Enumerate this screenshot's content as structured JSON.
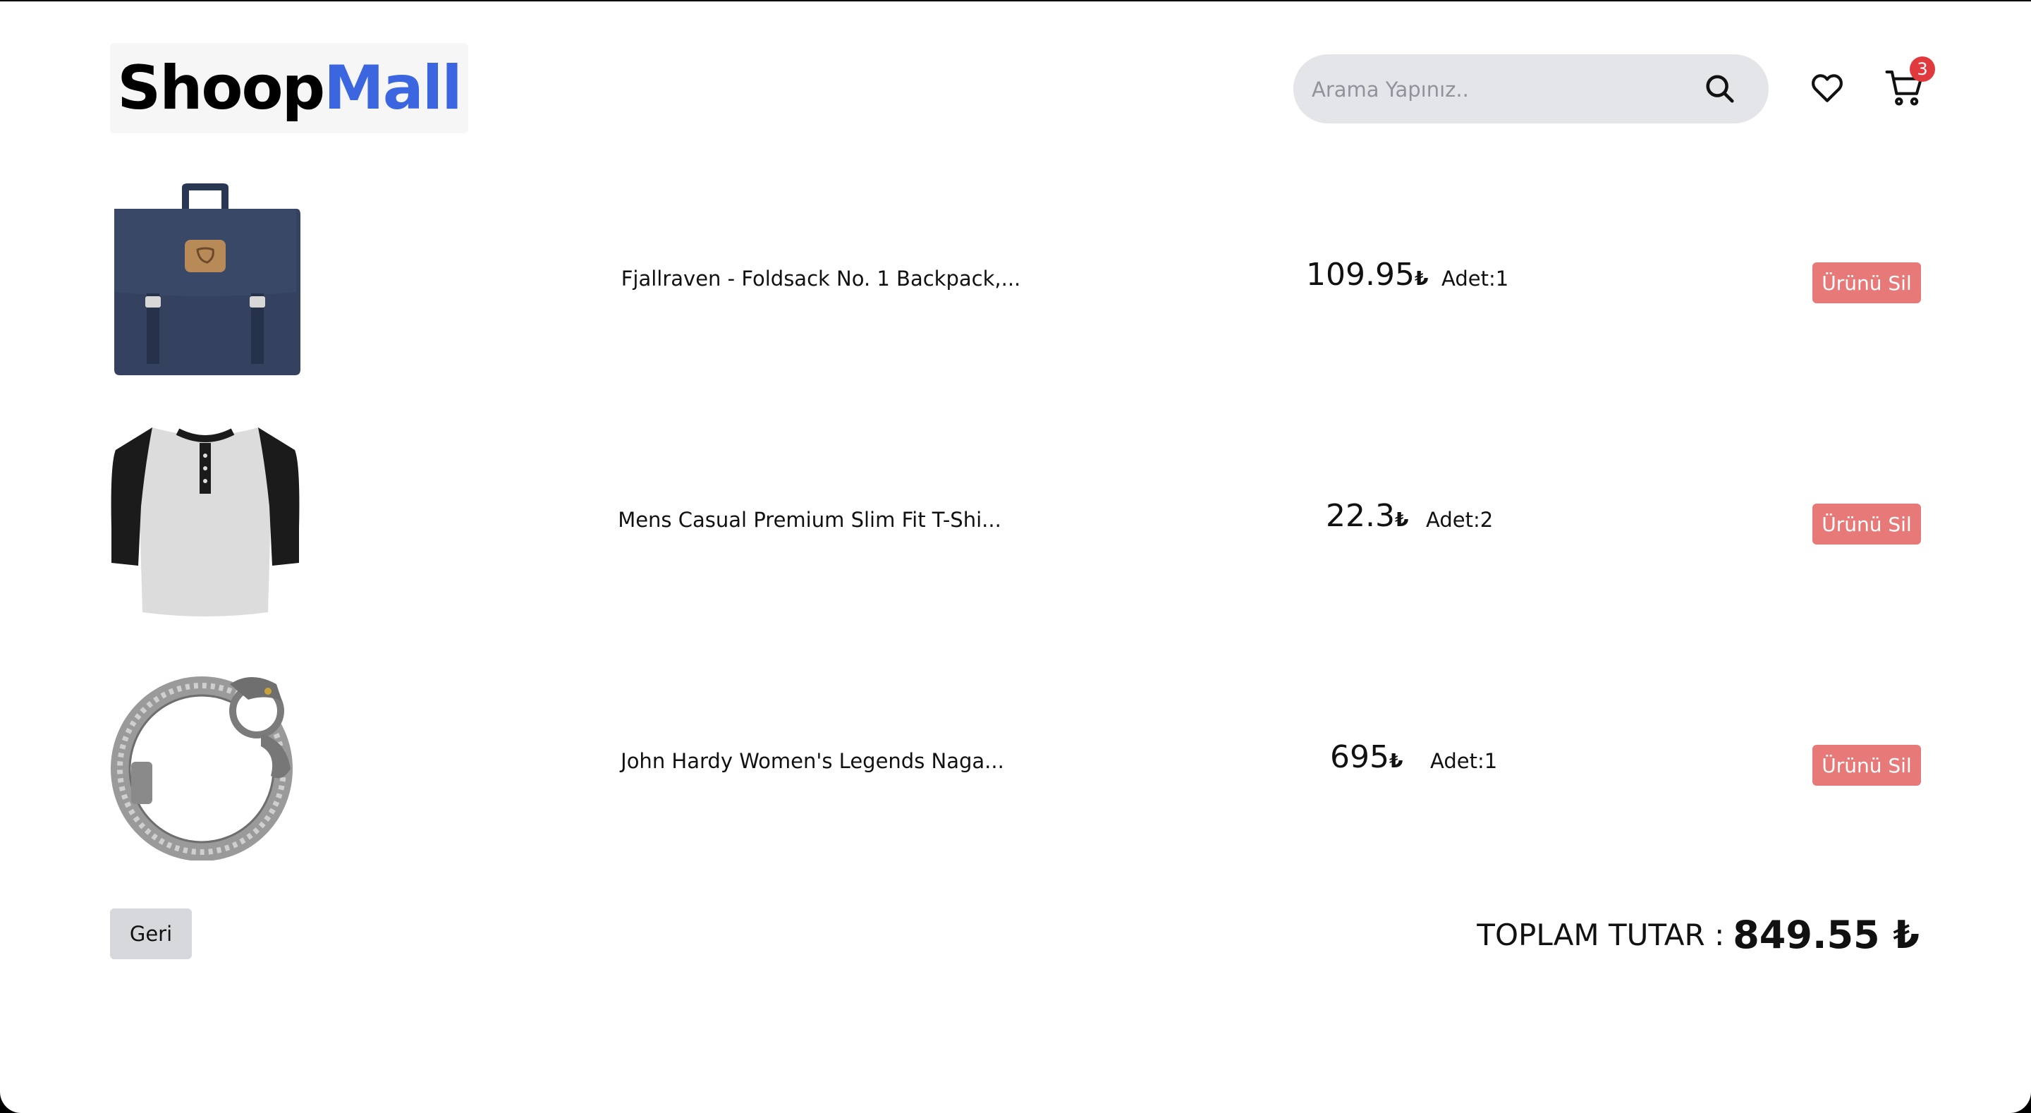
{
  "header": {
    "logo_part1": "Shoop",
    "logo_part2": "Mall",
    "search_placeholder": "Arama Yapınız..",
    "cart_count": "3"
  },
  "cart": {
    "items": [
      {
        "image": "navy-backpack",
        "name": "Fjallraven - Foldsack No. 1 Backpack,...",
        "price": "109.95",
        "currency": "₺",
        "qty": "Adet:1",
        "delete_label": "Ürünü Sil"
      },
      {
        "image": "raglan-tshirt",
        "name": "Mens Casual Premium Slim Fit T-Shi...",
        "price": "22.3",
        "currency": "₺",
        "qty": "Adet:2",
        "delete_label": "Ürünü Sil"
      },
      {
        "image": "silver-dragon-bracelet",
        "name": "John Hardy Women's Legends Naga...",
        "price": "695",
        "currency": "₺",
        "qty": "Adet:1",
        "delete_label": "Ürünü Sil"
      }
    ]
  },
  "footer": {
    "back_label": "Geri",
    "total_label": "TOPLAM TUTAR :",
    "total_value": "849.55 ₺"
  },
  "colors": {
    "brand_blue": "#3b66e0",
    "delete_button": "#e77a78",
    "badge_red": "#e0393e",
    "search_bg": "#e4e5e8"
  },
  "icons": [
    "search-icon",
    "heart-icon",
    "cart-icon"
  ]
}
